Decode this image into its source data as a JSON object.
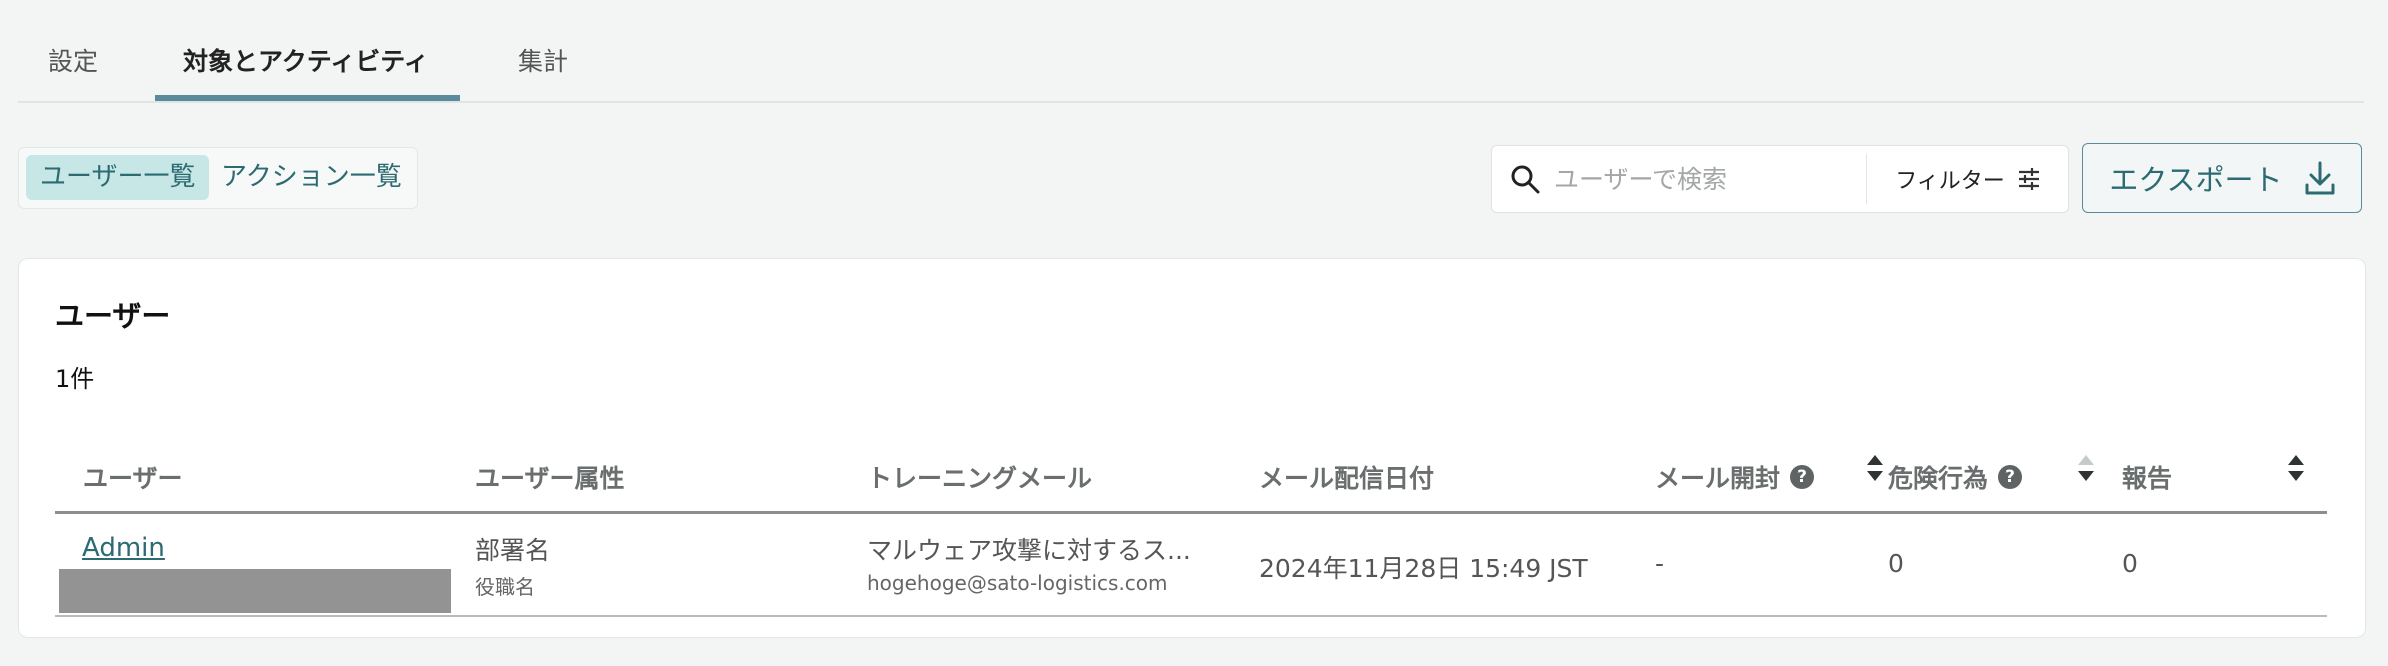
{
  "tabs": [
    {
      "label": "設定"
    },
    {
      "label": "対象とアクティビティ"
    },
    {
      "label": "集計"
    }
  ],
  "view_toggle": [
    {
      "label": "ユーザー一覧"
    },
    {
      "label": "アクション一覧"
    }
  ],
  "search": {
    "placeholder": "ユーザーで検索",
    "value": ""
  },
  "filter": {
    "label": "フィルター"
  },
  "export": {
    "label": "エクスポート"
  },
  "card": {
    "title": "ユーザー",
    "count": "1件",
    "columns": [
      "ユーザー",
      "ユーザー属性",
      "トレーニングメール",
      "メール配信日付",
      "メール開封",
      "危険行為",
      "報告"
    ],
    "rows": [
      {
        "user": "Admin",
        "dept": "部署名",
        "position": "役職名",
        "mail_title": "マルウェア攻撃に対するス...",
        "mail_address": "hogehoge@sato-logistics.com",
        "sent_date": "2024年11月28日 15:49 JST",
        "opened": "-",
        "risky": "0",
        "reported": "0"
      }
    ]
  },
  "colors": {
    "accent": "#5b8a9c",
    "teal_text": "#2c6b71",
    "active_toggle": "#c7e6e6"
  }
}
